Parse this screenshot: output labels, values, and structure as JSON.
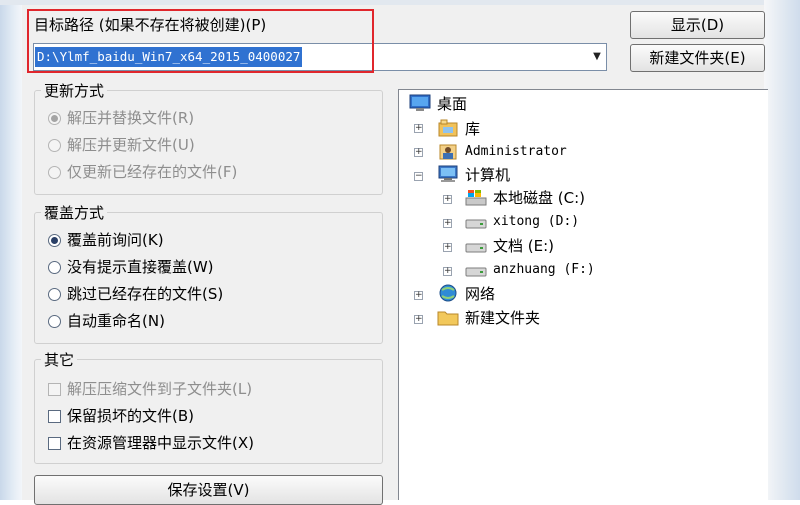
{
  "path_section": {
    "label": "目标路径 (如果不存在将被创建)(P)",
    "value": "D:\\Ylmf_baidu_Win7_x64_2015_0400027"
  },
  "buttons": {
    "show": "显示(D)",
    "new_folder": "新建文件夹(E)",
    "save_settings": "保存设置(V)"
  },
  "update_mode": {
    "title": "更新方式",
    "options": [
      {
        "label": "解压并替换文件(R)",
        "selected": true
      },
      {
        "label": "解压并更新文件(U)",
        "selected": false
      },
      {
        "label": "仅更新已经存在的文件(F)",
        "selected": false
      }
    ]
  },
  "overwrite_mode": {
    "title": "覆盖方式",
    "options": [
      {
        "label": "覆盖前询问(K)",
        "selected": true
      },
      {
        "label": "没有提示直接覆盖(W)",
        "selected": false
      },
      {
        "label": "跳过已经存在的文件(S)",
        "selected": false
      },
      {
        "label": "自动重命名(N)",
        "selected": false
      }
    ]
  },
  "other": {
    "title": "其它",
    "options": [
      {
        "label": "解压压缩文件到子文件夹(L)",
        "checked": false,
        "enabled": false
      },
      {
        "label": "保留损坏的文件(B)",
        "checked": false,
        "enabled": true
      },
      {
        "label": "在资源管理器中显示文件(X)",
        "checked": false,
        "enabled": true
      }
    ]
  },
  "tree": {
    "desktop": "桌面",
    "library": "库",
    "admin": "Administrator",
    "computer": "计算机",
    "drive_c": "本地磁盘 (C:)",
    "drive_d": "xitong (D:)",
    "drive_e": "文档 (E:)",
    "drive_f": "anzhuang (F:)",
    "network": "网络",
    "new_folder": "新建文件夹"
  },
  "colors": {
    "highlight_border": "#e0262c",
    "selection": "#3072d1",
    "dialog_bg": "#f0f0f0"
  },
  "icons": [
    "monitor-icon",
    "library-icon",
    "user-icon",
    "computer-icon",
    "system-drive-icon",
    "drive-icon",
    "network-icon",
    "folder-icon",
    "expander-plus-icon",
    "expander-minus-icon",
    "dropdown-arrow-icon"
  ]
}
